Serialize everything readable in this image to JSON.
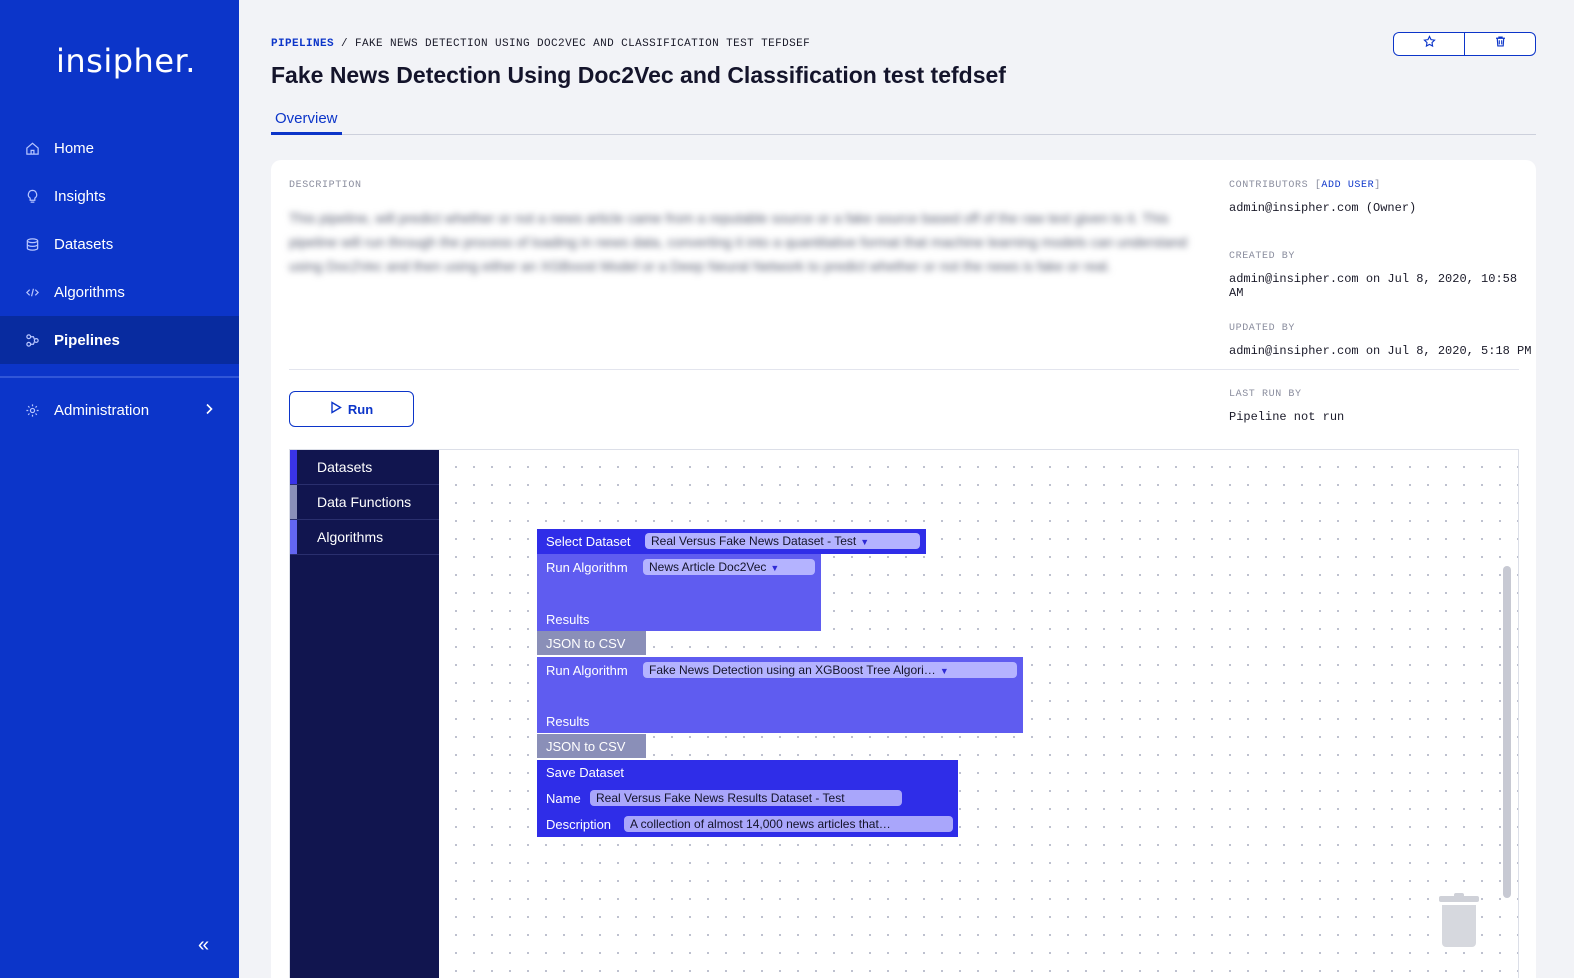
{
  "sidebar": {
    "logo": "insipher.",
    "items": [
      {
        "label": "Home",
        "icon": "home-icon"
      },
      {
        "label": "Insights",
        "icon": "lightbulb-icon"
      },
      {
        "label": "Datasets",
        "icon": "database-icon"
      },
      {
        "label": "Algorithms",
        "icon": "code-icon"
      },
      {
        "label": "Pipelines",
        "icon": "pipeline-icon",
        "active": true
      }
    ],
    "admin": {
      "label": "Administration",
      "icon": "gear-icon"
    },
    "collapse_glyph": "«"
  },
  "header": {
    "breadcrumb": {
      "root": "PIPELINES",
      "separator": " / ",
      "current": "FAKE NEWS DETECTION USING DOC2VEC AND CLASSIFICATION TEST TEFDSEF"
    },
    "title": "Fake News Detection Using Doc2Vec and Classification test tefdsef",
    "tabs": [
      {
        "label": "Overview",
        "active": true
      }
    ]
  },
  "details": {
    "description_label": "DESCRIPTION",
    "description": "This pipeline, will predict whether or not a news article came from a reputable source or a fake source based off of the raw text given to it. This pipeline will run through the process of loading in news data, converting it into a quantitative format that machine learning models can understand using Doc2Vec and then using either an XGBoost Model or a Deep Neural Network to predict whether or not the news is fake or real.",
    "contributors_label": "CONTRIBUTORS",
    "add_user": "ADD USER",
    "contributors": "admin@insipher.com (Owner)",
    "created_label": "CREATED BY",
    "created": "admin@insipher.com on Jul 8, 2020, 10:58 AM",
    "updated_label": "UPDATED BY",
    "updated": "admin@insipher.com on Jul 8, 2020, 5:18 PM",
    "last_run_label": "LAST RUN BY",
    "last_run": "Pipeline not run",
    "run_label": "Run"
  },
  "toolbox": {
    "categories": [
      {
        "label": "Datasets",
        "color": "#3a34e8"
      },
      {
        "label": "Data Functions",
        "color": "#8a8fb8"
      },
      {
        "label": "Algorithms",
        "color": "#6366f1"
      }
    ]
  },
  "blocks": {
    "select_dataset": {
      "label": "Select Dataset",
      "value": "Real Versus Fake News Dataset - Test"
    },
    "run_algorithm_1": {
      "label": "Run Algorithm",
      "value": "News Article Doc2Vec",
      "results": "Results"
    },
    "json_to_csv_1": {
      "label": "JSON to CSV"
    },
    "run_algorithm_2": {
      "label": "Run Algorithm",
      "value": "Fake News Detection using an XGBoost Tree Algori…",
      "results": "Results"
    },
    "json_to_csv_2": {
      "label": "JSON to CSV"
    },
    "save_dataset": {
      "label": "Save Dataset",
      "name_label": "Name",
      "name_value": "Real Versus Fake News Results Dataset - Test",
      "description_label": "Description",
      "description_value": "A collection of almost 14,000 news articles that…"
    }
  },
  "colors": {
    "sidebar": "#0c35c9",
    "sidebar_active": "#082b9f",
    "toolbox": "#11154f",
    "dataset_block": "#2f2de8",
    "algorithm_block": "#5f5cf0",
    "function_block": "#8a8fb8"
  }
}
